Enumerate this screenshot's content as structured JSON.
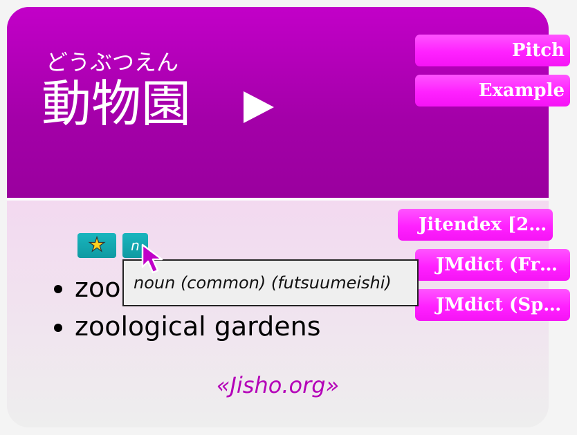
{
  "header": {
    "reading": "どうぶつえん",
    "term": "動物園",
    "play_icon": "play-icon"
  },
  "buttons": {
    "pitch": "Pitch",
    "example": "Example",
    "dict1": "Jitendex [2…",
    "dict2": "JMdict (Fr…",
    "dict3": "JMdict (Sp…"
  },
  "tags": {
    "star_icon": "star-icon",
    "pos": "n"
  },
  "tooltip": "noun (common) (futsuumeishi)",
  "definitions": [
    "zoo",
    "zoological gardens"
  ],
  "source": "«Jisho.org»",
  "colors": {
    "header": "#b000b6",
    "button": "#ff33ff",
    "tag": "#14a8b1",
    "source": "#b400b8"
  }
}
